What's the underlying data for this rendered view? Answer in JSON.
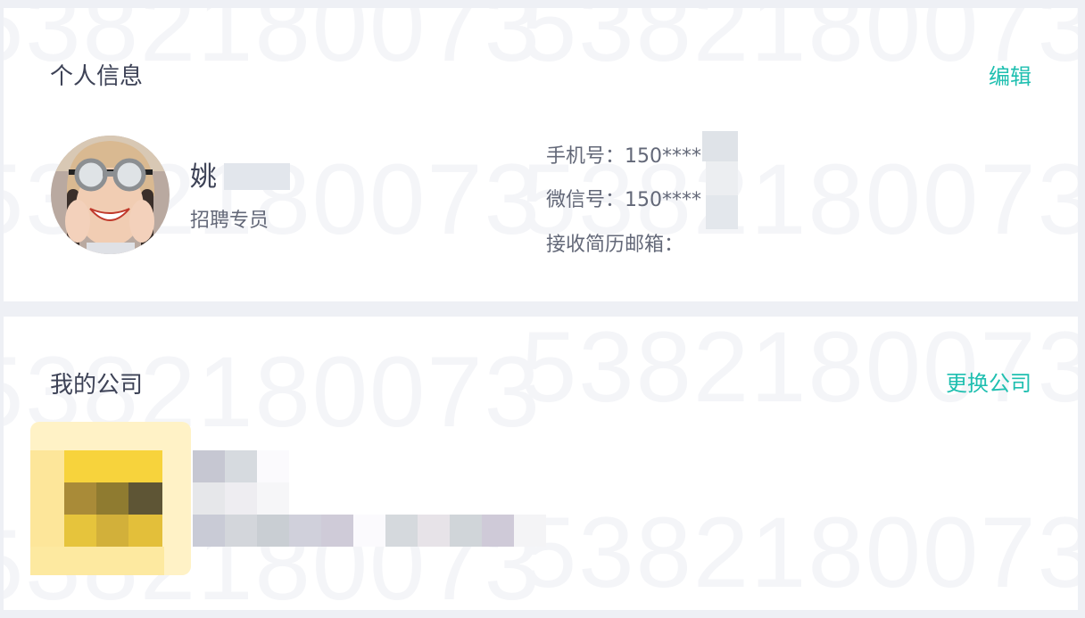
{
  "profile": {
    "title": "个人信息",
    "edit_label": "编辑",
    "name": "姚",
    "role": "招聘专员",
    "phone_label": "手机号：",
    "phone_value": "150****",
    "wechat_label": "微信号：",
    "wechat_value": "150****",
    "email_label": "接收简历邮箱：",
    "email_value": ""
  },
  "company": {
    "title": "我的公司",
    "change_label": "更换公司"
  },
  "watermark_text": "5382180073",
  "colors": {
    "accent": "#1fbfb0",
    "title_text": "#3d4256",
    "body_text": "#636878",
    "page_bg": "#eef0f5"
  }
}
